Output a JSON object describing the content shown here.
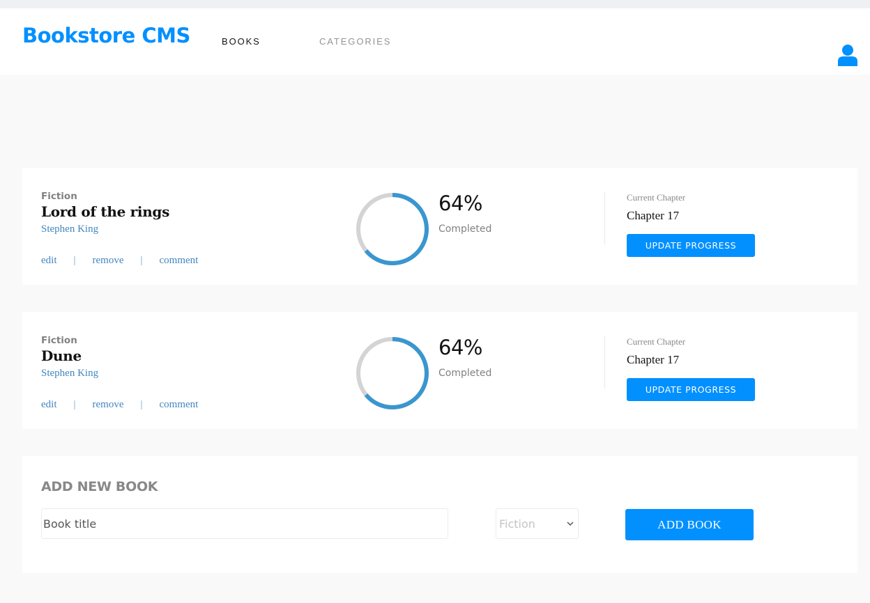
{
  "header": {
    "logo": "Bookstore CMS",
    "nav": {
      "books": "BOOKS",
      "categories": "CATEGORIES"
    }
  },
  "colors": {
    "accent": "#0290ff",
    "progress": "#3a96cf",
    "track": "#d4d4d4"
  },
  "books": [
    {
      "category": "Fiction",
      "title": "Lord of the rings",
      "author": "Stephen King",
      "actions": {
        "edit": "edit",
        "remove": "remove",
        "comment": "comment",
        "separator": "|"
      },
      "percent": "64%",
      "percent_value": 64,
      "completed_label": "Completed",
      "chapter_label": "Current Chapter",
      "chapter": "Chapter 17",
      "update_label": "UPDATE PROGRESS"
    },
    {
      "category": "Fiction",
      "title": "Dune",
      "author": "Stephen King",
      "actions": {
        "edit": "edit",
        "remove": "remove",
        "comment": "comment",
        "separator": "|"
      },
      "percent": "64%",
      "percent_value": 64,
      "completed_label": "Completed",
      "chapter_label": "Current Chapter",
      "chapter": "Chapter 17",
      "update_label": "UPDATE PROGRESS"
    }
  ],
  "add_form": {
    "title": "ADD NEW BOOK",
    "title_placeholder": "Book title",
    "category_value": "Fiction",
    "submit_label": "ADD BOOK"
  },
  "icons": {
    "user": "user-icon",
    "select_arrow": "chevron-down-icon"
  }
}
